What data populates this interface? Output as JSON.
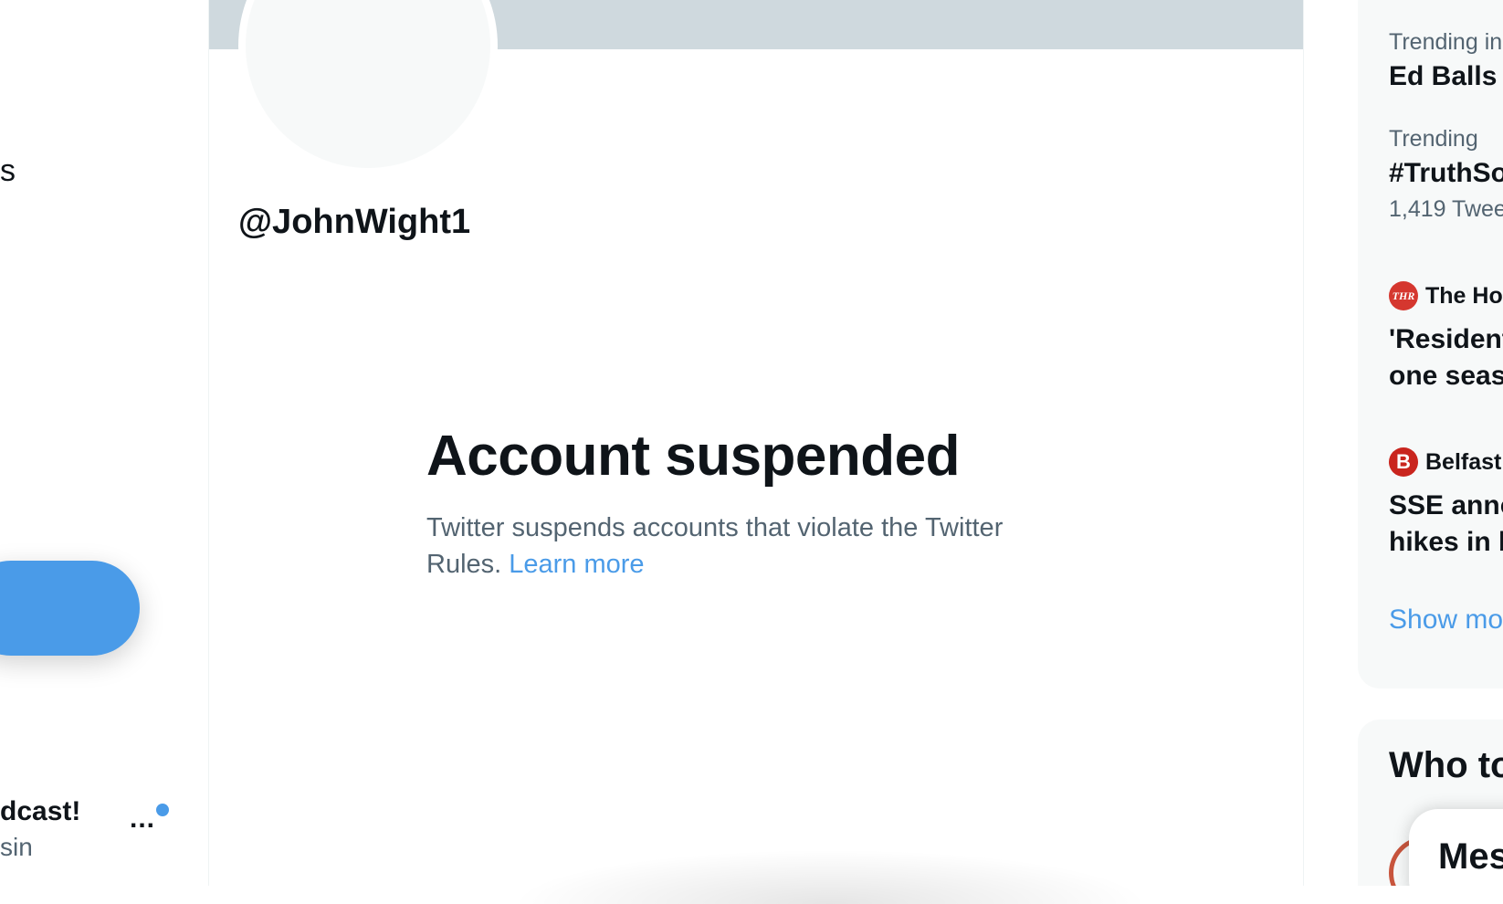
{
  "sidebar": {
    "nav_partial_text": "s",
    "account": {
      "name": "dcast!",
      "handle": "sin",
      "more_label": "..."
    }
  },
  "profile": {
    "handle": "@JohnWight1",
    "suspended_title": "Account suspended",
    "suspended_text": "Twitter suspends accounts that violate the Twitter Rules.",
    "learn_more": "Learn more"
  },
  "trends": {
    "items": [
      {
        "meta": "Trending in",
        "title": "Ed Balls"
      },
      {
        "meta": "Trending",
        "title": "#TruthSo",
        "count": "1,419 Twee"
      }
    ],
    "news": [
      {
        "source_icon": "THR",
        "source": "The Ho",
        "title_lines": [
          "'Resident",
          "one seas"
        ]
      },
      {
        "source_icon": "B",
        "source": "Belfast",
        "title_lines": [
          "SSE anno",
          "hikes in b"
        ]
      }
    ],
    "show_more": "Show mo"
  },
  "who_to_follow": {
    "title": "Who to"
  },
  "messages": {
    "label": "Mes"
  },
  "colors": {
    "accent": "#4a9be8",
    "text_primary": "#0f1419",
    "text_secondary": "#536471",
    "banner": "#cfd9de",
    "card_bg": "#f7f9f9"
  }
}
